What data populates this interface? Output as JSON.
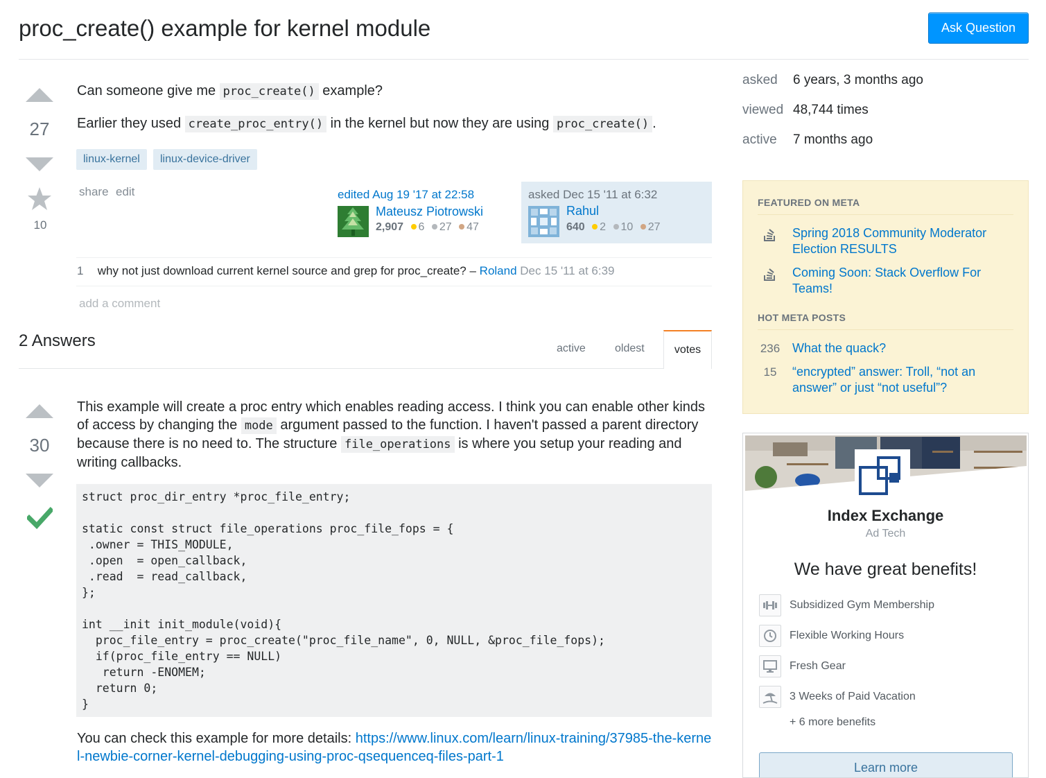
{
  "header": {
    "title": "proc_create() example for kernel module",
    "ask_button": "Ask Question"
  },
  "question": {
    "votes": "27",
    "favorites": "10",
    "body": {
      "line1_a": "Can someone give me",
      "line1_code": "proc_create()",
      "line1_b": "example?",
      "line2_a": "Earlier they used",
      "line2_code1": "create_proc_entry()",
      "line2_b": "in the kernel but now they are using",
      "line2_code2": "proc_create()",
      "line2_c": "."
    },
    "tags": [
      "linux-kernel",
      "linux-device-driver"
    ],
    "menu": {
      "share": "share",
      "edit": "edit"
    },
    "editor": {
      "action": "edited Aug 19 '17 at 22:58",
      "name": "Mateusz Piotrowski",
      "rep": "2,907",
      "gold": "6",
      "silver": "27",
      "bronze": "47"
    },
    "owner": {
      "action": "asked Dec 15 '11 at 6:32",
      "name": "Rahul",
      "rep": "640",
      "gold": "2",
      "silver": "10",
      "bronze": "27"
    },
    "comment": {
      "score": "1",
      "text": "why not just download current kernel source and grep for proc_create? –",
      "user": "Roland",
      "date": "Dec 15 '11 at 6:39"
    },
    "add_comment": "add a comment"
  },
  "answers_header": {
    "count": "2 Answers",
    "tabs": [
      "active",
      "oldest",
      "votes"
    ]
  },
  "answer": {
    "votes": "30",
    "p1_a": "This example will create a proc entry which enables reading access. I think you can enable other kinds of access by changing the",
    "p1_code1": "mode",
    "p1_b": "argument passed to the function. I haven't passed a parent directory because there is no need to. The structure",
    "p1_code2": "file_operations",
    "p1_c": "is where you setup your reading and writing callbacks.",
    "code": "struct proc_dir_entry *proc_file_entry;\n\nstatic const struct file_operations proc_file_fops = {\n .owner = THIS_MODULE,\n .open  = open_callback,\n .read  = read_callback,\n};\n\nint __init init_module(void){\n  proc_file_entry = proc_create(\"proc_file_name\", 0, NULL, &proc_file_fops);\n  if(proc_file_entry == NULL)\n   return -ENOMEM;\n  return 0;\n}",
    "p2_a": "You can check this example for more details:",
    "p2_link": "https://www.linux.com/learn/linux-training/37985-the-kernel-newbie-corner-kernel-debugging-using-proc-qsequenceq-files-part-1"
  },
  "sidebar": {
    "stats": [
      {
        "label": "asked",
        "value": "6 years, 3 months ago"
      },
      {
        "label": "viewed",
        "value": "48,744 times"
      },
      {
        "label": "active",
        "value": "7 months ago"
      }
    ],
    "featured_head": "FEATURED ON META",
    "featured": [
      "Spring 2018 Community Moderator Election RESULTS",
      "Coming Soon: Stack Overflow For Teams!"
    ],
    "hot_head": "HOT META POSTS",
    "hot": [
      {
        "num": "236",
        "text": "What the quack?"
      },
      {
        "num": "15",
        "text": "“encrypted” answer: Troll, “not an answer” or just “not useful”?"
      }
    ]
  },
  "job_ad": {
    "company": "Index Exchange",
    "industry": "Ad Tech",
    "headline": "We have great benefits!",
    "benefits": [
      {
        "icon": "dumbbell-icon",
        "text": "Subsidized Gym Membership"
      },
      {
        "icon": "clock-icon",
        "text": "Flexible Working Hours"
      },
      {
        "icon": "monitor-icon",
        "text": "Fresh Gear"
      },
      {
        "icon": "beach-icon",
        "text": "3 Weeks of Paid Vacation"
      }
    ],
    "more": "+ 6 more benefits",
    "button": "Learn more"
  },
  "colors": {
    "link": "#0077cc",
    "button": "#0095ff",
    "tag_bg": "#e1ecf4",
    "tag_fg": "#39739d",
    "accepted": "#48a868",
    "gold": "#ffcc01",
    "silver": "#b4b8bc",
    "bronze": "#d1a684",
    "meta_bg": "#fbf3d5",
    "owner_bg": "#e1ecf4"
  }
}
